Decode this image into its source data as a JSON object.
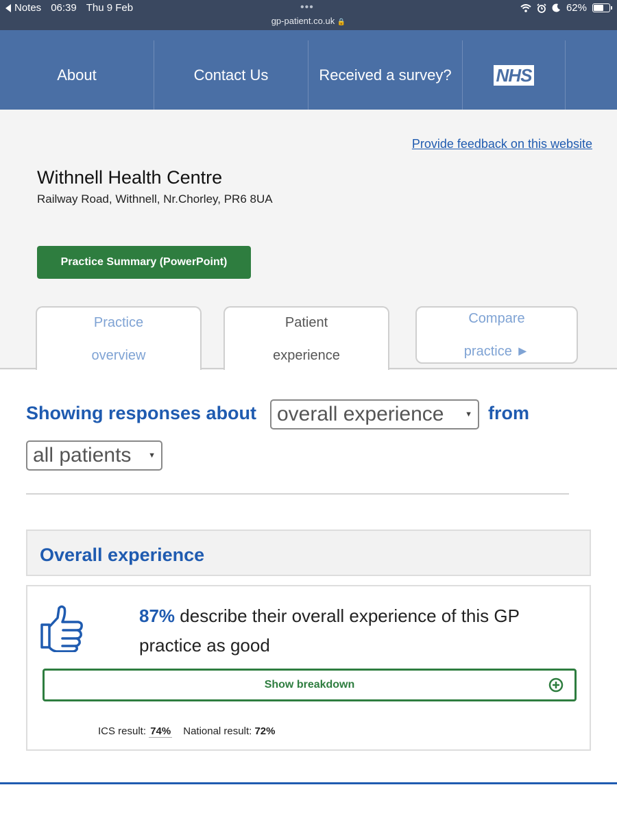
{
  "status_bar": {
    "back_app": "Notes",
    "time": "06:39",
    "date": "Thu 9 Feb",
    "battery": "62%",
    "battery_level": 0.62,
    "url": "gp-patient.co.uk"
  },
  "nav": {
    "items": [
      "About",
      "Contact Us",
      "Received a survey?"
    ],
    "logo": "NHS"
  },
  "header": {
    "feedback_link": "Provide feedback on this website",
    "practice_name": "Withnell Health Centre",
    "practice_address": "Railway Road, Withnell, Nr.Chorley, PR6 8UA",
    "summary_button": "Practice Summary (PowerPoint)"
  },
  "tabs": [
    {
      "line1": "Practice",
      "line2": "overview"
    },
    {
      "line1": "Patient",
      "line2": "experience"
    },
    {
      "line1": "Compare",
      "line2": "practice ►"
    }
  ],
  "filter": {
    "prefix": "Showing responses about",
    "topic_value": "overall experience",
    "connector": "from",
    "group_value": "all patients"
  },
  "section": {
    "title": "Overall experience",
    "percentage": "87%",
    "statement": " describe their overall experience of this GP practice as good",
    "breakdown_button": "Show breakdown",
    "ics_label": "ICS result:",
    "ics_value": "74%",
    "national_label": "National result:",
    "national_value": "72%"
  },
  "colors": {
    "nav_bg": "#4a6fa5",
    "brand_blue": "#1f5bb0",
    "nhs_green": "#2e7d3f"
  }
}
